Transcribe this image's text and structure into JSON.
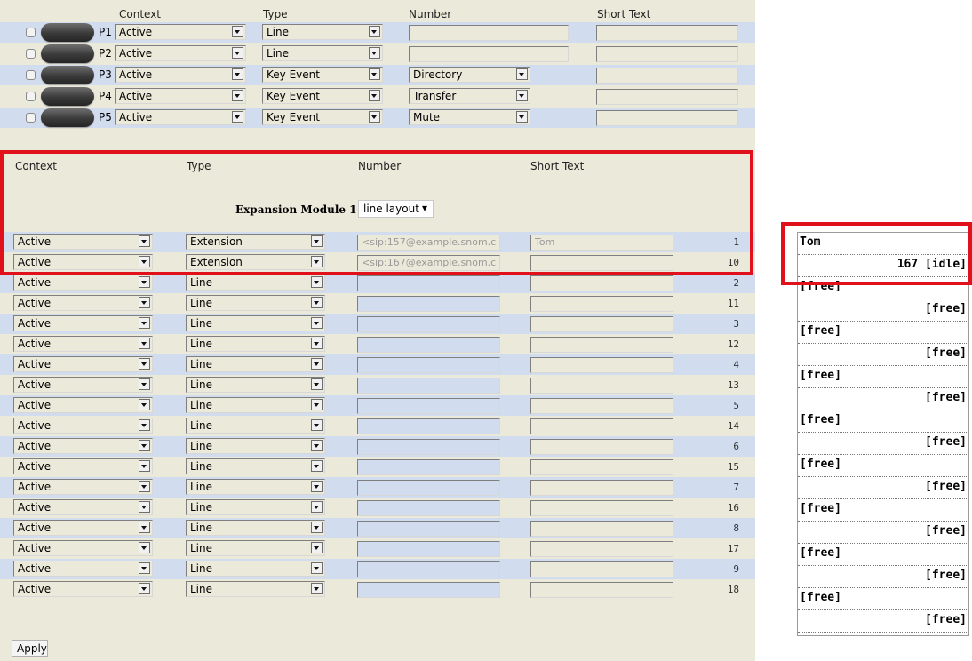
{
  "top": {
    "headers": {
      "context": "Context",
      "type": "Type",
      "number": "Number",
      "short_text": "Short Text"
    },
    "keys": [
      {
        "label": "P1",
        "context": "Active",
        "type": "Line",
        "number_select": "",
        "short_text": ""
      },
      {
        "label": "P2",
        "context": "Active",
        "type": "Line",
        "number_select": "",
        "short_text": ""
      },
      {
        "label": "P3",
        "context": "Active",
        "type": "Key Event",
        "number_select": "Directory",
        "short_text": ""
      },
      {
        "label": "P4",
        "context": "Active",
        "type": "Key Event",
        "number_select": "Transfer",
        "short_text": ""
      },
      {
        "label": "P5",
        "context": "Active",
        "type": "Key Event",
        "number_select": "Mute",
        "short_text": ""
      }
    ]
  },
  "expansion": {
    "headers": {
      "context": "Context",
      "type": "Type",
      "number": "Number",
      "short_text": "Short Text"
    },
    "module_label": "Expansion Module 1",
    "layout_value": "line layout",
    "layout_arrow": "▾",
    "rows": [
      {
        "context": "Active",
        "type": "Extension",
        "number": "<sip:157@example.snom.c",
        "short_text": "Tom",
        "index": "1"
      },
      {
        "context": "Active",
        "type": "Extension",
        "number": "<sip:167@example.snom.c",
        "short_text": "",
        "index": "10"
      },
      {
        "context": "Active",
        "type": "Line",
        "number": "",
        "short_text": "",
        "index": "2"
      },
      {
        "context": "Active",
        "type": "Line",
        "number": "",
        "short_text": "",
        "index": "11"
      },
      {
        "context": "Active",
        "type": "Line",
        "number": "",
        "short_text": "",
        "index": "3"
      },
      {
        "context": "Active",
        "type": "Line",
        "number": "",
        "short_text": "",
        "index": "12"
      },
      {
        "context": "Active",
        "type": "Line",
        "number": "",
        "short_text": "",
        "index": "4"
      },
      {
        "context": "Active",
        "type": "Line",
        "number": "",
        "short_text": "",
        "index": "13"
      },
      {
        "context": "Active",
        "type": "Line",
        "number": "",
        "short_text": "",
        "index": "5"
      },
      {
        "context": "Active",
        "type": "Line",
        "number": "",
        "short_text": "",
        "index": "14"
      },
      {
        "context": "Active",
        "type": "Line",
        "number": "",
        "short_text": "",
        "index": "6"
      },
      {
        "context": "Active",
        "type": "Line",
        "number": "",
        "short_text": "",
        "index": "15"
      },
      {
        "context": "Active",
        "type": "Line",
        "number": "",
        "short_text": "",
        "index": "7"
      },
      {
        "context": "Active",
        "type": "Line",
        "number": "",
        "short_text": "",
        "index": "16"
      },
      {
        "context": "Active",
        "type": "Line",
        "number": "",
        "short_text": "",
        "index": "8"
      },
      {
        "context": "Active",
        "type": "Line",
        "number": "",
        "short_text": "",
        "index": "17"
      },
      {
        "context": "Active",
        "type": "Line",
        "number": "",
        "short_text": "",
        "index": "9"
      },
      {
        "context": "Active",
        "type": "Line",
        "number": "",
        "short_text": "",
        "index": "18"
      }
    ],
    "apply_label": "Apply"
  },
  "display": {
    "cells": [
      {
        "left": "Tom",
        "right": ""
      },
      {
        "left": "",
        "right": "167 [idle]"
      },
      {
        "left": "[free]",
        "right": ""
      },
      {
        "left": "",
        "right": "[free]"
      },
      {
        "left": "[free]",
        "right": ""
      },
      {
        "left": "",
        "right": "[free]"
      },
      {
        "left": "[free]",
        "right": ""
      },
      {
        "left": "",
        "right": "[free]"
      },
      {
        "left": "[free]",
        "right": ""
      },
      {
        "left": "",
        "right": "[free]"
      },
      {
        "left": "[free]",
        "right": ""
      },
      {
        "left": "",
        "right": "[free]"
      },
      {
        "left": "[free]",
        "right": ""
      },
      {
        "left": "",
        "right": "[free]"
      },
      {
        "left": "[free]",
        "right": ""
      },
      {
        "left": "",
        "right": "[free]"
      },
      {
        "left": "[free]",
        "right": ""
      },
      {
        "left": "",
        "right": "[free]"
      }
    ]
  },
  "colors": {
    "highlight": "#e0111b",
    "row_blue": "#d2dcef",
    "row_beige": "#ebe9d9"
  }
}
